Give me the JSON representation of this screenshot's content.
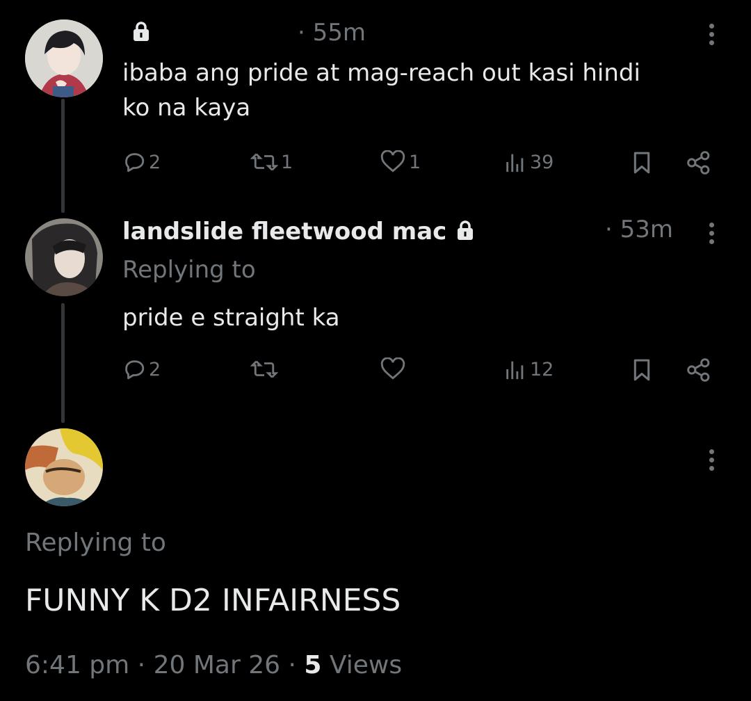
{
  "tweet1": {
    "name": "",
    "time": "55m",
    "text_line1": "ibaba ang pride at mag-reach out kasi hindi",
    "text_line2": "ko na kaya",
    "replies": "2",
    "reposts": "1",
    "likes": "1",
    "views": "39"
  },
  "tweet2": {
    "name": "landslide fleetwood mac",
    "time": "53m",
    "replying_label": "Replying to",
    "text": "pride e straight ka",
    "replies": "2",
    "reposts": "",
    "likes": "",
    "views": "12"
  },
  "tweet3": {
    "name": "",
    "replying_label": "Replying to",
    "text": "FUNNY K D2 INFAIRNESS",
    "time": "6:41 pm",
    "date": "20 Mar 26",
    "views_count": "5",
    "views_label": "Views",
    "separator": "·"
  },
  "icons": {
    "reply": "reply-bubble-icon",
    "repost": "repost-icon",
    "like": "heart-icon",
    "views": "views-bar-icon",
    "bookmark": "bookmark-icon",
    "share": "share-icon",
    "more": "more-vertical-icon",
    "lock": "lock-icon"
  },
  "colors": {
    "background": "#000000",
    "text": "#e7e9ea",
    "muted": "#71767b",
    "thread_line": "#333639"
  }
}
